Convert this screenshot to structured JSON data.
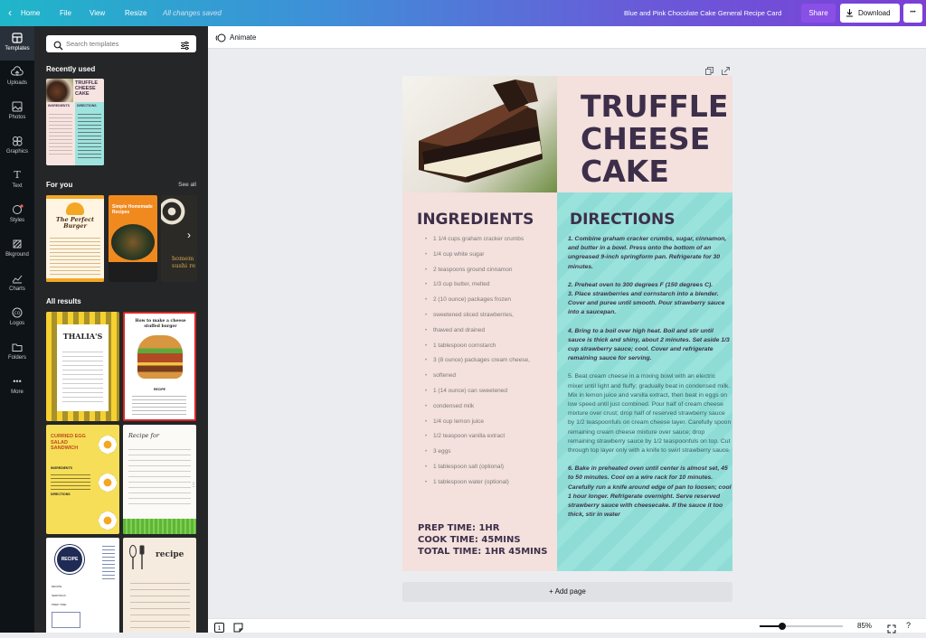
{
  "topbar": {
    "home": "Home",
    "file": "File",
    "view": "View",
    "resize": "Resize",
    "status": "All changes saved",
    "doc_title": "Blue and Pink Chocolate Cake General Recipe Card",
    "share": "Share",
    "download": "Download",
    "more": "•••"
  },
  "rail": [
    {
      "label": "Templates",
      "icon": "templates-icon"
    },
    {
      "label": "Uploads",
      "icon": "uploads-icon"
    },
    {
      "label": "Photos",
      "icon": "photos-icon"
    },
    {
      "label": "Graphics",
      "icon": "graphics-icon"
    },
    {
      "label": "Text",
      "icon": "text-icon"
    },
    {
      "label": "Styles",
      "icon": "styles-icon"
    },
    {
      "label": "Bkground",
      "icon": "background-icon"
    },
    {
      "label": "Charts",
      "icon": "charts-icon"
    },
    {
      "label": "Logos",
      "icon": "logos-icon"
    },
    {
      "label": "Folders",
      "icon": "folders-icon"
    },
    {
      "label": "More",
      "icon": "more-icon"
    }
  ],
  "panel": {
    "search_placeholder": "Search templates",
    "recent_heading": "Recently used",
    "recent_thumb": {
      "title": "TRUFFLE CHEESE CAKE",
      "ing": "INGREDIENTS",
      "dir": "DIRECTIONS"
    },
    "foryou_heading": "For you",
    "see_all": "See all",
    "foryou": [
      {
        "title": "The Perfect Burger"
      },
      {
        "title": "Simple Homemade Recipes"
      },
      {
        "title": "homem sushi re"
      }
    ],
    "all_heading": "All results",
    "results": [
      {
        "title": "THALIA'S"
      },
      {
        "title": "How to make a cheese stuffed burger",
        "sub": "RECIPE"
      },
      {
        "title": "CURRIED EGG SALAD SANDWICH",
        "ing": "INGREDIENTS",
        "dir": "DIRECTIONS"
      },
      {
        "title": "Recipe for"
      },
      {
        "title": "RECIPE",
        "f1": "RECIPE:",
        "f2": "SERVINGS:",
        "f3": "PREP TIME:"
      },
      {
        "title": "recipe"
      }
    ]
  },
  "subbar": {
    "animate": "Animate"
  },
  "card": {
    "title": [
      "TRUFFLE",
      "CHEESE",
      "CAKE"
    ],
    "ingredients_heading": "INGREDIENTS",
    "directions_heading": "DIRECTIONS",
    "ingredients": [
      "1 1/4 cups graham cracker crumbs",
      "1/4 cup white sugar",
      "2 teaspoons ground cinnamon",
      "1/3 cup butter, melted",
      "2 (10 ounce) packages frozen",
      "sweetened sliced strawberries,",
      "thawed and drained",
      "1 tablespoon cornstarch",
      "3 (8 ounce) packages cream cheese,",
      "softened",
      "1 (14 ounce) can sweetened",
      "condensed milk",
      "1/4 cup lemon juice",
      "1/2 teaspoon vanilla extract",
      "3 eggs",
      "1 tablespoon salt (optional)",
      "1 tablespoon water (optional)"
    ],
    "directions": [
      {
        "text": "1. Combine graham cracker crumbs, sugar, cinnamon, and butter in a bowl. Press onto the bottom of an ungreased 9-inch springform pan. Refrigerate for 30 minutes.",
        "style": "b"
      },
      {
        "text": "2. Preheat oven to 300 degrees F (150 degrees C).",
        "style": "b"
      },
      {
        "text": "3. Place strawberries and cornstarch into a blender. Cover and puree until smooth. Pour strawberry sauce into a saucepan.",
        "style": "b"
      },
      {
        "text": "4. Bring to a boil over high heat. Boil and stir until sauce is thick and shiny, about 2 minutes. Set aside 1/3 cup strawberry sauce; cool. Cover and refrigerate remaining sauce for serving.",
        "style": "b"
      },
      {
        "text": "5. Beat cream cheese in a mixing bowl with an electric mixer until light and fluffy; gradually beat in condensed milk. Mix in lemon juice and vanilla extract, then beat in eggs on low speed until just combined. Pour half of cream cheese mixture over crust; drop half of reserved strawberry sauce by 1/2 teaspoonfuls on cream cheese layer. Carefully spoon remaining cream cheese mixture over sauce; drop remaining strawberry sauce by 1/2 teaspoonfuls on top. Cut through top layer only with a knife to swirl strawberry sauce.",
        "style": "n"
      },
      {
        "text": "6. Bake in preheated oven until center is almost set, 45 to 50 minutes. Cool on a wire rack for 10 minutes. Carefully run a knife around edge of pan to loosen; cool 1 hour longer. Refrigerate overnight. Serve reserved strawberry sauce with cheesecake. If the sauce it too thick, stir in water",
        "style": "b"
      }
    ],
    "prep": "PREP TIME: 1HR",
    "cook": "COOK TIME: 45MINS",
    "total": "TOTAL TIME: 1HR 45MINS"
  },
  "add_page": "+ Add page",
  "bottom": {
    "zoom": "85%",
    "zoom_level": 0.27
  },
  "colors": {
    "accent": "#7d2ae8",
    "card_pink": "#f4e0dc",
    "card_teal": "#8fdcd6",
    "title_purple": "#3d2f4a"
  }
}
